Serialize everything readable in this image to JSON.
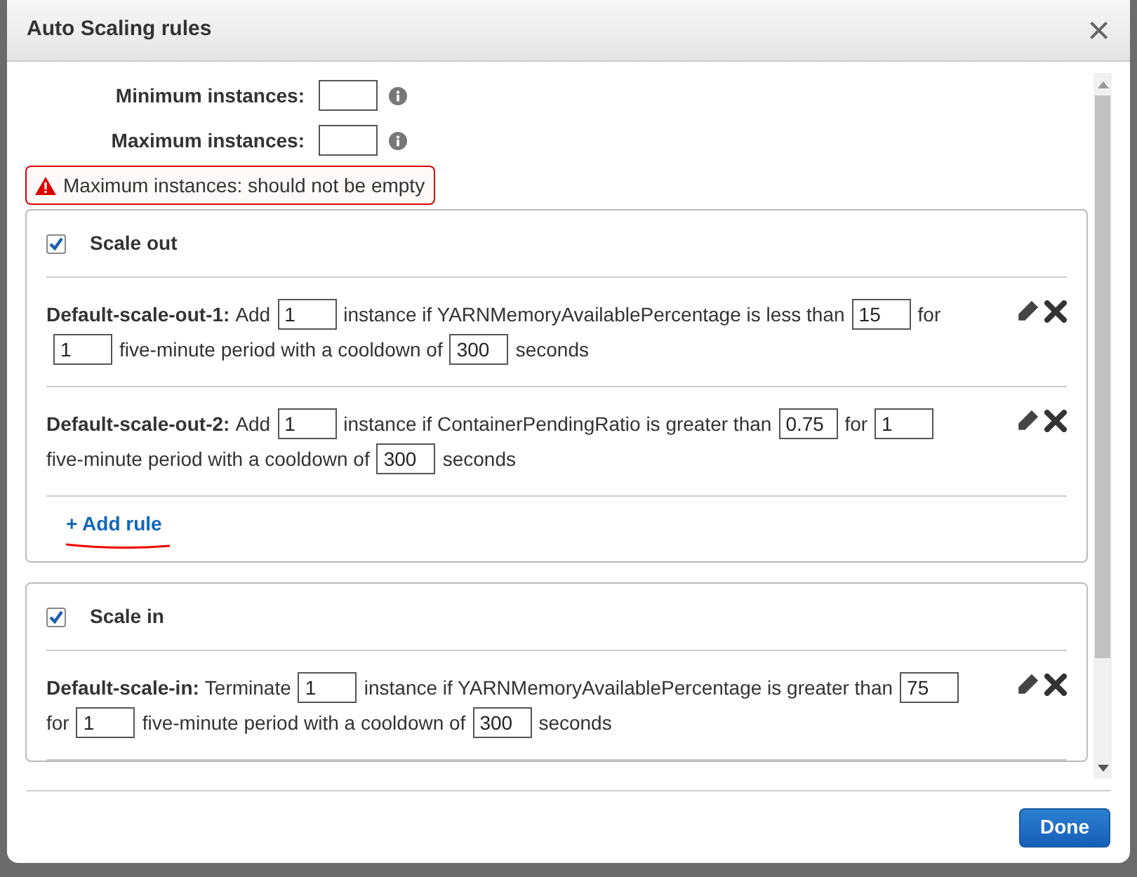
{
  "dialog": {
    "title": "Auto Scaling rules",
    "close_label": "×"
  },
  "limits": [
    {
      "label": "Minimum instances:"
    },
    {
      "label": "Maximum instances:"
    }
  ],
  "error": {
    "text": "Maximum instances: should not be empty"
  },
  "sections": [
    {
      "title": "Scale out",
      "checked": true,
      "add_rule": "+ Add rule",
      "rules": [
        {
          "name": "Default-scale-out-1:",
          "parts": [
            {
              "kind": "text",
              "text": "Add"
            },
            {
              "kind": "input",
              "value": "1"
            },
            {
              "kind": "text",
              "text": "instance if YARNMemoryAvailablePercentage is less than"
            },
            {
              "kind": "input",
              "value": "15"
            },
            {
              "kind": "text",
              "text": "for"
            },
            {
              "kind": "input",
              "value": "1"
            },
            {
              "kind": "text",
              "text": "five-minute period with a cooldown of"
            },
            {
              "kind": "input",
              "value": "300"
            },
            {
              "kind": "text",
              "text": "seconds"
            }
          ]
        },
        {
          "name": "Default-scale-out-2:",
          "parts": [
            {
              "kind": "text",
              "text": "Add"
            },
            {
              "kind": "input",
              "value": "1"
            },
            {
              "kind": "text",
              "text": "instance if ContainerPendingRatio is greater than"
            },
            {
              "kind": "input",
              "value": "0.75"
            },
            {
              "kind": "text",
              "text": "for"
            },
            {
              "kind": "input",
              "value": "1"
            },
            {
              "kind": "text",
              "text": "five-minute period with a cooldown of"
            },
            {
              "kind": "input",
              "value": "300"
            },
            {
              "kind": "text",
              "text": "seconds"
            }
          ]
        }
      ]
    },
    {
      "title": "Scale in",
      "checked": true,
      "rules": [
        {
          "name": "Default-scale-in:",
          "parts": [
            {
              "kind": "text",
              "text": "Terminate"
            },
            {
              "kind": "input",
              "value": "1"
            },
            {
              "kind": "text",
              "text": "instance if YARNMemoryAvailablePercentage is greater than"
            },
            {
              "kind": "input",
              "value": "75"
            },
            {
              "kind": "text",
              "text": "for"
            },
            {
              "kind": "input",
              "value": "1"
            },
            {
              "kind": "text",
              "text": "five-minute period with a cooldown of"
            },
            {
              "kind": "input",
              "value": "300"
            },
            {
              "kind": "text",
              "text": "seconds"
            }
          ]
        }
      ]
    }
  ],
  "done_button": "Done"
}
